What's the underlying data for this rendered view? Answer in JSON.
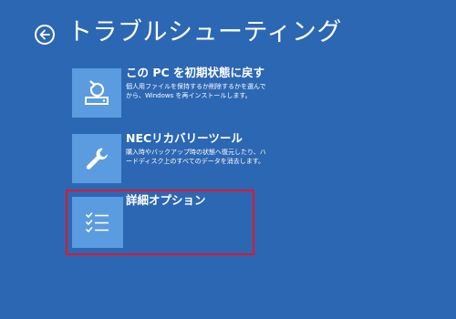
{
  "header": {
    "title": "トラブルシューティング",
    "back_icon": "back-arrow-icon"
  },
  "options": [
    {
      "title": "この PC を初期状態に戻す",
      "description": "個人用ファイルを保持するか削除するかを選んでから、Windows を再インストールします。",
      "icon": "reset-icon"
    },
    {
      "title": "NECリカバリーツール",
      "description": "購入時やバックアップ時の状態へ復元したり、ハードディスク上のすべてのデータを消去します。",
      "icon": "wrench-icon"
    },
    {
      "title": "詳細オプション",
      "description": "",
      "icon": "checklist-icon"
    }
  ],
  "colors": {
    "background": "#2c67b3",
    "tile": "#5b9be0",
    "highlight": "#e0172a"
  }
}
